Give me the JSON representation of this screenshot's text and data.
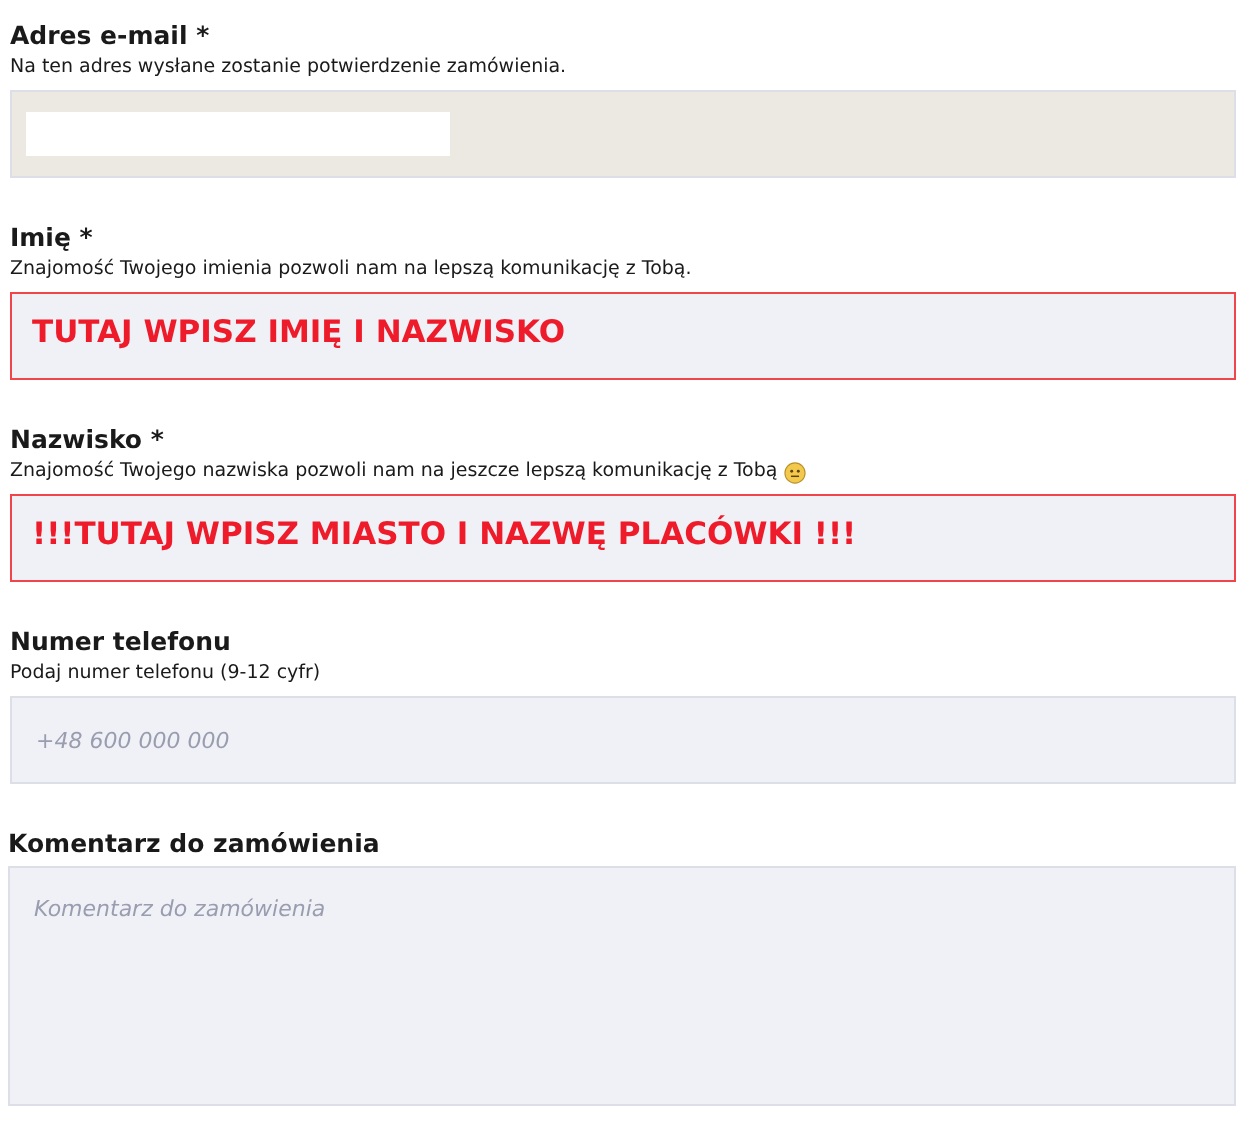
{
  "fields": [
    {
      "kind": "text",
      "label": "Adres e-mail *",
      "hint": "Na ten adres wysłane zostanie potwierdzenie zamówienia.",
      "hint_icon": false,
      "autofilled": true,
      "redacted": true,
      "invalid": false
    },
    {
      "kind": "text",
      "label": "Imię *",
      "hint": "Znajomość Twojego imienia pozwoli nam na lepszą komunikację z Tobą.",
      "hint_icon": false,
      "value": "TUTAJ WPISZ IMIĘ I NAZWISKO",
      "autofilled": false,
      "redacted": false,
      "invalid": true
    },
    {
      "kind": "text",
      "label": "Nazwisko *",
      "hint": "Znajomość Twojego nazwiska pozwoli nam na jeszcze lepszą komunikację z Tobą",
      "hint_icon": true,
      "value": "!!!TUTAJ WPISZ MIASTO I NAZWĘ PLACÓWKI !!!",
      "autofilled": false,
      "redacted": false,
      "invalid": true
    },
    {
      "kind": "text",
      "label": "Numer telefonu",
      "hint": "Podaj numer telefonu (9-12 cyfr)",
      "hint_icon": false,
      "placeholder": "+48 600 000 000",
      "autofilled": false,
      "redacted": false,
      "invalid": false
    },
    {
      "kind": "textarea",
      "label": "Komentarz do zamówienia",
      "hint_icon": false,
      "placeholder": "Komentarz do zamówienia",
      "autofilled": false,
      "redacted": false,
      "invalid": false
    }
  ]
}
